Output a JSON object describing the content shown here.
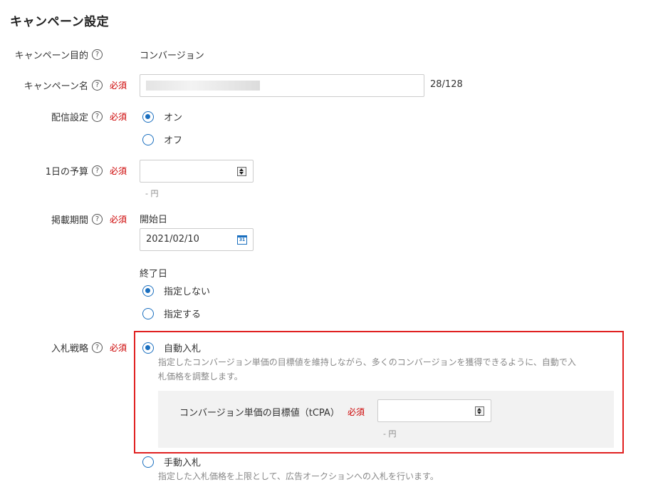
{
  "page": {
    "title": "キャンペーン設定"
  },
  "fields": {
    "objective": {
      "label": "キャンペーン目的",
      "help": "?",
      "value": "コンバージョン"
    },
    "name": {
      "label": "キャンペーン名",
      "help": "?",
      "required": "必須",
      "value": "",
      "counter": "28/128"
    },
    "delivery": {
      "label": "配信設定",
      "help": "?",
      "required": "必須",
      "on": "オン",
      "off": "オフ",
      "selected": "オン"
    },
    "budget": {
      "label": "1日の予算",
      "help": "?",
      "required": "必須",
      "value": "",
      "hint": "- 円"
    },
    "period": {
      "label": "掲載期間",
      "help": "?",
      "required": "必須",
      "start_label": "開始日",
      "start_value": "2021/02/10",
      "calendar_icon": "31",
      "end_label": "終了日",
      "end_option_none": "指定しない",
      "end_option_set": "指定する",
      "selected": "指定しない"
    },
    "bidding": {
      "label": "入札戦略",
      "help": "?",
      "required": "必須",
      "auto": {
        "label": "自動入札",
        "desc1": "指定したコンバージョン単価の目標値を維持しながら、多くのコンバージョンを獲得できるように、自動で入",
        "desc2": "札価格を調整します。",
        "tcpa_label": "コンバージョン単価の目標値（tCPA）",
        "tcpa_required": "必須",
        "tcpa_value": "",
        "tcpa_hint": "- 円"
      },
      "manual": {
        "label": "手動入札",
        "desc": "指定した入札価格を上限として、広告オークションへの入札を行います。"
      },
      "selected": "自動入札"
    }
  },
  "colors": {
    "accent": "#1a6fbf",
    "required": "#cc0000",
    "highlight": "#e02020",
    "panel": "#f2f2f2"
  }
}
